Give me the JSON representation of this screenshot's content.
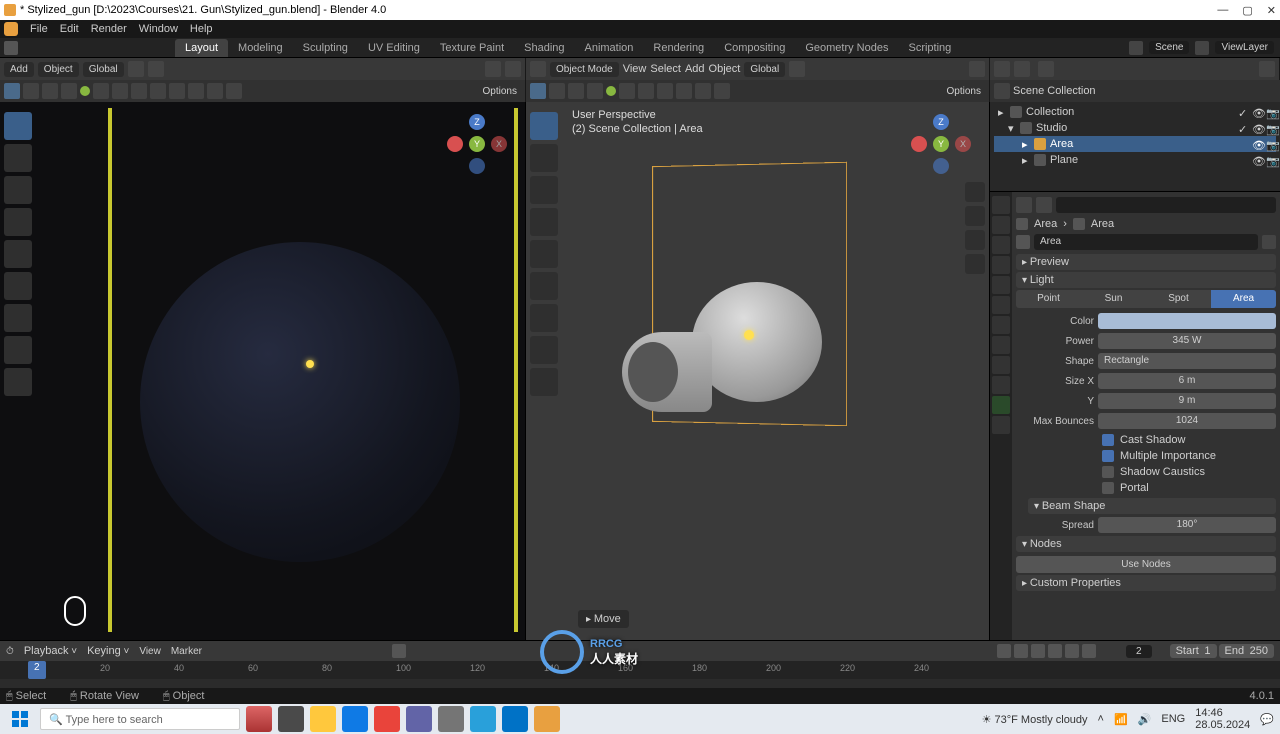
{
  "titlebar": {
    "title": "* Stylized_gun [D:\\2023\\Courses\\21. Gun\\Stylized_gun.blend] - Blender 4.0"
  },
  "menubar": {
    "items": [
      "File",
      "Edit",
      "Render",
      "Window",
      "Help"
    ]
  },
  "workspace": {
    "tabs": [
      "Layout",
      "Modeling",
      "Sculpting",
      "UV Editing",
      "Texture Paint",
      "Shading",
      "Animation",
      "Rendering",
      "Compositing",
      "Geometry Nodes",
      "Scripting"
    ],
    "active": 0,
    "scene_label": "Scene",
    "viewlayer_label": "ViewLayer"
  },
  "vp_header_a": {
    "add": "Add",
    "object": "Object",
    "orient": "Global"
  },
  "vp_header_b": {
    "mode": "Object Mode",
    "menus": [
      "View",
      "Select",
      "Add",
      "Object"
    ],
    "orient": "Global"
  },
  "toolbar": {
    "options": "Options"
  },
  "viewport_right": {
    "line1": "User Perspective",
    "line2": "(2) Scene Collection | Area",
    "hint": "Move"
  },
  "outliner": {
    "root": "Scene Collection",
    "items": [
      {
        "name": "Collection",
        "depth": 1
      },
      {
        "name": "Studio",
        "depth": 1
      },
      {
        "name": "Area",
        "depth": 2,
        "selected": true
      },
      {
        "name": "Plane",
        "depth": 2
      }
    ]
  },
  "props": {
    "crumb1": "Area",
    "crumb2": "Area",
    "name": "Area",
    "preview": "Preview",
    "light": "Light",
    "types": [
      "Point",
      "Sun",
      "Spot",
      "Area"
    ],
    "type_sel": 3,
    "color_label": "Color",
    "color_value": "#8fa9c8",
    "power_label": "Power",
    "power_value": "345 W",
    "shape_label": "Shape",
    "shape_value": "Rectangle",
    "sizex_label": "Size X",
    "sizex_value": "6 m",
    "sizey_label": "Y",
    "sizey_value": "9 m",
    "bounces_label": "Max Bounces",
    "bounces_value": "1024",
    "cast_shadow": "Cast Shadow",
    "multi_imp": "Multiple Importance",
    "shadow_caustics": "Shadow Caustics",
    "portal": "Portal",
    "beam": "Beam Shape",
    "spread_label": "Spread",
    "spread_value": "180°",
    "nodes": "Nodes",
    "use_nodes": "Use Nodes",
    "custom": "Custom Properties"
  },
  "timeline": {
    "playback": "Playback",
    "keying": "Keying",
    "view": "View",
    "marker": "Marker",
    "current": "2",
    "start_label": "Start",
    "start": "1",
    "end_label": "End",
    "end": "250",
    "ticks": [
      "20",
      "40",
      "60",
      "80",
      "100",
      "120",
      "140",
      "160",
      "180",
      "200",
      "220",
      "240"
    ]
  },
  "statusbar": {
    "select": "Select",
    "rotate": "Rotate View",
    "object": "Object",
    "version": "4.0.1"
  },
  "taskbar": {
    "search_placeholder": "Type here to search",
    "weather": "73°F  Mostly cloudy",
    "time": "14:46",
    "date": "28.05.2024"
  },
  "watermark": {
    "text": "RRCG",
    "sub": "人人素材"
  }
}
